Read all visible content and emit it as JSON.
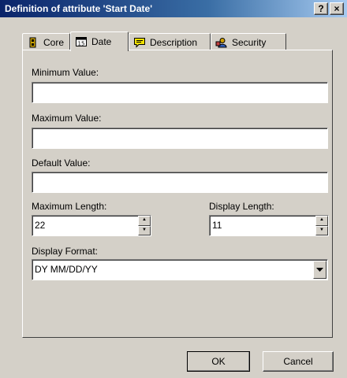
{
  "window": {
    "title": "Definition of attribute 'Start Date'",
    "help_label": "?",
    "close_label": "×"
  },
  "tabs": [
    {
      "label": "Core",
      "icon": "core-icon",
      "active": false
    },
    {
      "label": "Date",
      "icon": "calendar-icon",
      "active": true
    },
    {
      "label": "Description",
      "icon": "description-icon",
      "active": false
    },
    {
      "label": "Security",
      "icon": "security-icon",
      "active": false
    }
  ],
  "form": {
    "min_label": "Minimum Value:",
    "min_value": "",
    "max_label": "Maximum Value:",
    "max_value": "",
    "default_label": "Default Value:",
    "default_value": "",
    "max_length_label": "Maximum Length:",
    "max_length_value": "22",
    "display_length_label": "Display Length:",
    "display_length_value": "11",
    "display_format_label": "Display Format:",
    "display_format_value": "DY MM/DD/YY"
  },
  "buttons": {
    "ok": "OK",
    "cancel": "Cancel"
  },
  "colors": {
    "titlebar_start": "#0a246a",
    "face": "#d4d0c8",
    "core_icon": "#c8a000",
    "description_icon": "#f0e000",
    "security_icon": "#d0a000"
  }
}
